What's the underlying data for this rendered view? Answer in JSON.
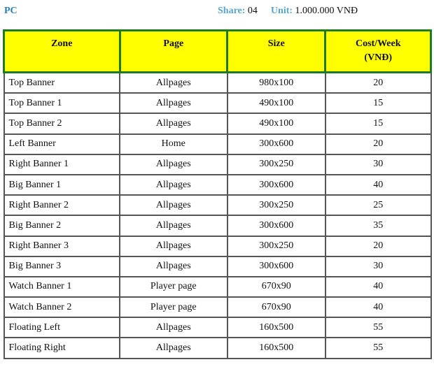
{
  "title": "PC",
  "meta": {
    "share_label": "Share:",
    "share_value": "04",
    "unit_label": "Unit:",
    "unit_value": "1.000.000 VNĐ"
  },
  "table": {
    "headers": [
      "Zone",
      "Page",
      "Size",
      "Cost/Week",
      "(VNĐ)"
    ],
    "rows": [
      {
        "zone": "Top Banner",
        "page": "Allpages",
        "size": "980x100",
        "cost": "20"
      },
      {
        "zone": "Top Banner 1",
        "page": "Allpages",
        "size": "490x100",
        "cost": "15"
      },
      {
        "zone": "Top Banner 2",
        "page": "Allpages",
        "size": "490x100",
        "cost": "15"
      },
      {
        "zone": "Left Banner",
        "page": "Home",
        "size": "300x600",
        "cost": "20"
      },
      {
        "zone": "Right Banner 1",
        "page": "Allpages",
        "size": "300x250",
        "cost": "30"
      },
      {
        "zone": "Big Banner 1",
        "page": "Allpages",
        "size": "300x600",
        "cost": "40"
      },
      {
        "zone": "Right Banner 2",
        "page": "Allpages",
        "size": "300x250",
        "cost": "25"
      },
      {
        "zone": "Big Banner 2",
        "page": "Allpages",
        "size": "300x600",
        "cost": "35"
      },
      {
        "zone": "Right Banner 3",
        "page": "Allpages",
        "size": "300x250",
        "cost": "20"
      },
      {
        "zone": "Big Banner 3",
        "page": "Allpages",
        "size": "300x600",
        "cost": "30"
      },
      {
        "zone": "Watch Banner 1",
        "page": "Player page",
        "size": "670x90",
        "cost": "40"
      },
      {
        "zone": "Watch Banner 2",
        "page": "Player page",
        "size": "670x90",
        "cost": "40"
      },
      {
        "zone": "Floating Left",
        "page": "Allpages",
        "size": "160x500",
        "cost": "55"
      },
      {
        "zone": "Floating Right",
        "page": "Allpages",
        "size": "160x500",
        "cost": "55"
      }
    ]
  }
}
